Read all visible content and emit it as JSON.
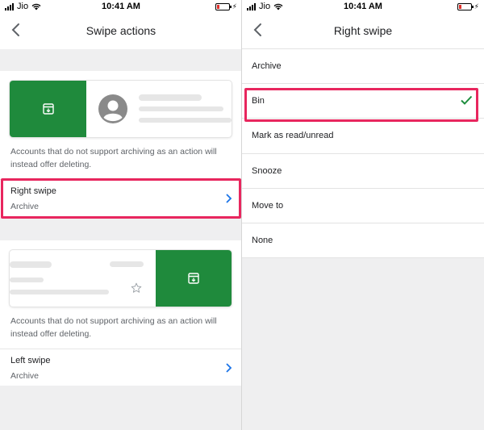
{
  "status_bar": {
    "carrier": "Jio",
    "time": "10:41 AM"
  },
  "left": {
    "title": "Swipe actions",
    "right_swipe": {
      "description": "Accounts that do not support archiving as an action will instead offer deleting.",
      "label": "Right swipe",
      "value": "Archive"
    },
    "left_swipe": {
      "description": "Accounts that do not support archiving as an action will instead offer deleting.",
      "label": "Left swipe",
      "value": "Archive"
    }
  },
  "right": {
    "title": "Right swipe",
    "options": [
      {
        "label": "Archive",
        "selected": false
      },
      {
        "label": "Bin",
        "selected": true
      },
      {
        "label": "Mark as read/unread",
        "selected": false
      },
      {
        "label": "Snooze",
        "selected": false
      },
      {
        "label": "Move to",
        "selected": false
      },
      {
        "label": "None",
        "selected": false
      }
    ]
  },
  "colors": {
    "accent_green": "#1f8a3c",
    "highlight": "#e8265e",
    "chevron_blue": "#1a73e8",
    "check_green": "#1e8e3e"
  },
  "icons": {
    "back": "chevron-left-icon",
    "archive": "archive-icon",
    "chevron": "chevron-right-icon",
    "avatar": "avatar-icon",
    "star": "star-icon",
    "check": "checkmark-icon"
  }
}
